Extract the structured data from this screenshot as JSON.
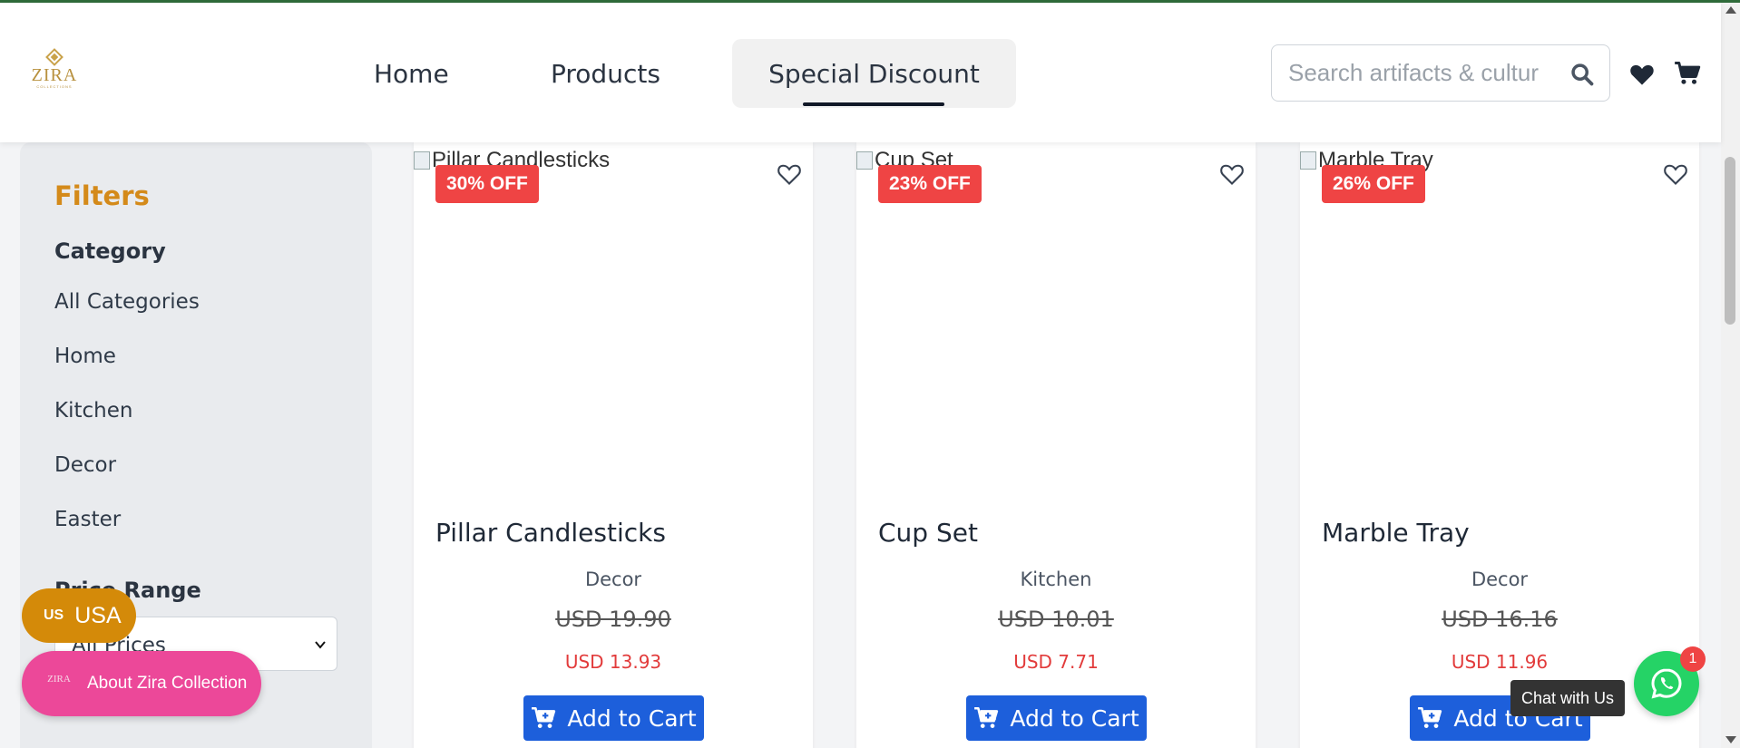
{
  "header": {
    "logo_text": "ZIRA",
    "logo_subtext": "COLLECTIONS",
    "nav": {
      "home": "Home",
      "products": "Products",
      "special": "Special Discount"
    },
    "search_placeholder": "Search artifacts & cultur"
  },
  "filters": {
    "title": "Filters",
    "category_heading": "Category",
    "categories": [
      "All Categories",
      "Home",
      "Kitchen",
      "Decor",
      "Easter"
    ],
    "price_heading": "Price Range",
    "price_selected": "All Prices"
  },
  "products": [
    {
      "img_alt": "Pillar Candlesticks",
      "badge": "30% OFF",
      "name": "Pillar Candlesticks",
      "category": "Decor",
      "old_price": "USD 19.90",
      "new_price": "USD 13.93",
      "button": "Add to Cart"
    },
    {
      "img_alt": "Cup Set",
      "badge": "23% OFF",
      "name": "Cup Set",
      "category": "Kitchen",
      "old_price": "USD 10.01",
      "new_price": "USD 7.71",
      "button": "Add to Cart"
    },
    {
      "img_alt": "Marble Tray",
      "badge": "26% OFF",
      "name": "Marble Tray",
      "category": "Decor",
      "old_price": "USD 16.16",
      "new_price": "USD 11.96",
      "button": "Add to Cart"
    }
  ],
  "floating": {
    "currency_code": "US",
    "currency_name": "USA",
    "about_label": "About Zira Collection",
    "about_logo": "ZIRA",
    "chat_tooltip": "Chat with Us",
    "chat_badge": "1"
  },
  "icons": {
    "search": "search-icon",
    "wishlist": "heart-icon",
    "cart": "cart-icon",
    "card_wishlist": "heart-outline-icon",
    "add_to_cart": "cart-plus-icon",
    "chat": "whatsapp-icon"
  },
  "colors": {
    "accent_filters": "#d48a1a",
    "discount_badge": "#ef4444",
    "button_blue": "#1d5fdb",
    "currency_pill": "#d48a09",
    "about_pill": "#ec4899",
    "whatsapp": "#25d366"
  }
}
